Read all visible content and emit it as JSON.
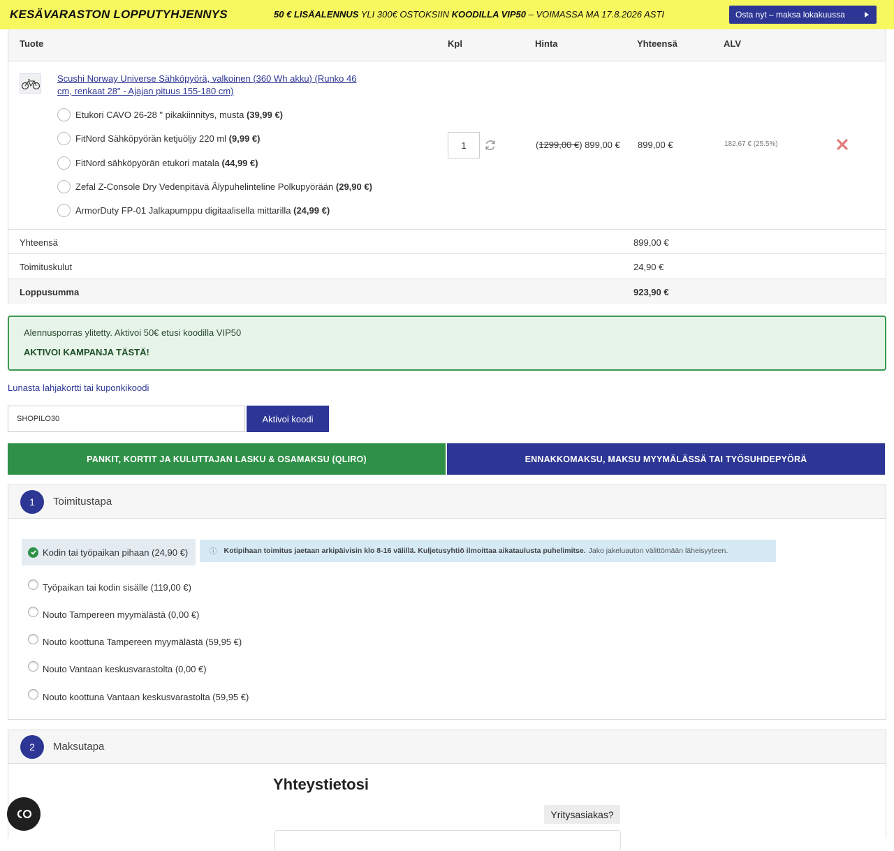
{
  "promo": {
    "title": "KESÄVARASTON LOPPUTYHJENNYS",
    "msg_part1": "50 € LISÄALENNUS",
    "msg_part2": " YLI 300€ OSTOKSIIN ",
    "msg_part3": "KOODILLA VIP50",
    "msg_part4": " – VOIMASSA MA 17.8.2026 ASTI",
    "cta": "Osta nyt –  maksa lokakuussa"
  },
  "cart": {
    "headers": {
      "product": "Tuote",
      "qty": "Kpl",
      "price": "Hinta",
      "total": "Yhteensä",
      "vat": "ALV"
    },
    "product": {
      "name": "Scushi Norway Universe Sähköpyörä, valkoinen (360 Wh akku) (Runko 46 cm, renkaat 28\" - Ajajan pituus 155-180 cm)",
      "qty": "1",
      "old_price": "1299,00 €",
      "price": "899,00 €",
      "line_total": "899,00 €",
      "vat": "182,67 € (25.5%)"
    },
    "addons": [
      {
        "name": "Etukori CAVO 26-28 \" pikakiinnitys, musta ",
        "price": "(39,99 €)"
      },
      {
        "name": "FitNord Sähköpyörän ketjuöljy 220 ml ",
        "price": "(9,99 €)"
      },
      {
        "name": "FitNord sähköpyörän etukori matala ",
        "price": "(44,99 €)"
      },
      {
        "name": "Zefal Z-Console Dry Vedenpitävä Älypuhelinteline Polkupyörään ",
        "price": "(29,90 €)"
      },
      {
        "name": "ArmorDuty FP-01 Jalkapumppu digitaalisella mittarilla ",
        "price": "(24,99 €)"
      }
    ],
    "summary": [
      {
        "label": "Yhteensä",
        "value": "899,00 €"
      },
      {
        "label": "Toimituskulut",
        "value": "24,90 €"
      },
      {
        "label": "Loppusumma",
        "value": "923,90 €"
      }
    ]
  },
  "notice": {
    "text": "Alennusporras ylitetty. Aktivoi 50€ etusi koodilla VIP50",
    "action": "AKTIVOI KAMPANJA TÄSTÄ!"
  },
  "coupon": {
    "link": "Lunasta lahjakortti tai kuponkikoodi",
    "value": "SHOPILO30",
    "button": "Aktivoi koodi"
  },
  "payment_tabs": {
    "left": "PANKIT, KORTIT JA KULUTTAJAN LASKU & OSAMAKSU (QLIRO)",
    "right": "ENNAKKOMAKSU, MAKSU MYYMÄLÄSSÄ TAI TYÖSUHDEPYÖRÄ"
  },
  "shipping": {
    "step": "1",
    "title": "Toimitustapa",
    "selected": "Kodin tai työpaikan pihaan (24,90 €)",
    "info_bold": "Kotipihaan toimitus jaetaan arkipäivisin klo 8-16 välillä. Kuljetusyhtiö ilmoittaa aikataulusta puhelimitse.",
    "info_rest": "Jako jakeluauton välittömään läheisyyteen.",
    "options": [
      "Työpaikan tai kodin sisälle (119,00 €)",
      "Nouto Tampereen myymälästä (0,00 €)",
      "Nouto koottuna Tampereen myymälästä (59,95 €)",
      "Nouto Vantaan keskusvarastolta (0,00 €)",
      "Nouto koottuna Vantaan keskusvarastolta (59,95 €)"
    ]
  },
  "payment": {
    "step": "2",
    "title": "Maksutapa",
    "contact_title": "Yhteystietosi",
    "corporate": "Yritysasiakas?"
  },
  "colors": {
    "brand_blue": "#2d3695",
    "green": "#2f9148",
    "promo_yellow": "#f7f760"
  }
}
